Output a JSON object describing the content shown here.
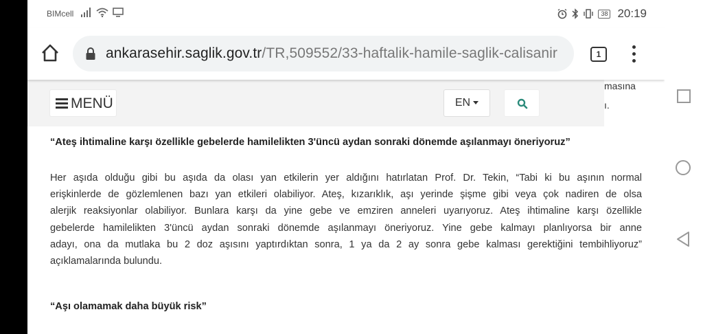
{
  "status_bar": {
    "carrier": "BIMcell",
    "battery": "38",
    "time": "20:19"
  },
  "browser": {
    "url_domain": "ankarasehir.saglik.gov.tr",
    "url_path": "/TR,509552/33-haftalik-hamile-saglik-calisanir",
    "tab_count": "1"
  },
  "site_nav": {
    "menu_label": "MENÜ",
    "language": "EN"
  },
  "peek": {
    "line1": "masına",
    "line2": "ı."
  },
  "article": {
    "heading1": "“Ateş ihtimaline karşı özellikle gebelerde hamilelikten 3'üncü aydan sonraki dönemde aşılanmayı öneriyoruz”",
    "paragraph_lines": [
      "Her aşıda olduğu gibi bu aşıda da olası yan etkilerin yer aldığını hatırlatan Prof. Dr. Tekin, “Tabi ki bu aşının normal",
      "erişkinlerde de gözlemlenen bazı yan etkileri olabiliyor. Ateş, kızarıklık, aşı yerinde şişme gibi veya çok nadiren de olsa",
      "alerjik reaksiyonlar olabiliyor. Bunlara karşı da yine gebe ve emziren anneleri uyarıyoruz. Ateş ihtimaline karşı özellikle",
      "gebelerde hamilelikten 3'üncü aydan sonraki dönemde aşılanmayı öneriyoruz. Yine gebe kalmayı planlıyorsa bir anne",
      "adayı, ona da mutlaka bu 2 doz aşısını yaptırdıktan sonra, 1 ya da 2 ay sonra gebe kalması gerektiğini tembihliyoruz”",
      "açıklamalarında bulundu."
    ],
    "heading2": "“Aşı olamamak daha büyük risk”"
  },
  "icons": {
    "signal": "signal-icon",
    "wifi": "wifi-icon",
    "cast": "screen-icon",
    "alarm": "alarm-icon",
    "bluetooth": "bluetooth-icon",
    "vibrate": "vibrate-icon",
    "home": "home-icon",
    "lock": "lock-icon",
    "search": "search-icon"
  },
  "colors": {
    "search_accent": "#2a8a7a",
    "nav_background": "#f3f3f3"
  }
}
